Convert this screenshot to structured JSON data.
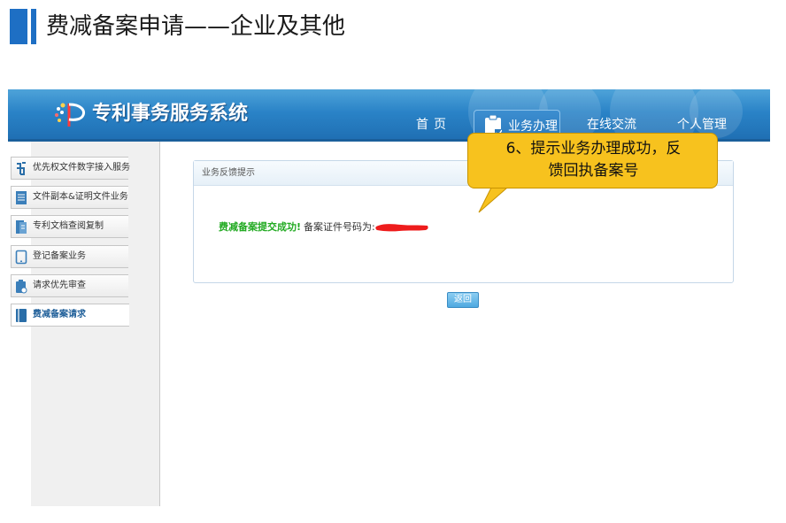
{
  "slide": {
    "title": "费减备案申请——企业及其他"
  },
  "app": {
    "logo_text": "专利事务服务系统",
    "brand_color": "#2a83c7"
  },
  "nav": {
    "items": [
      {
        "label": "首页",
        "active": false
      },
      {
        "label": "业务办理",
        "active": true
      },
      {
        "label": "在线交流",
        "active": false
      },
      {
        "label": "个人管理",
        "active": false
      }
    ]
  },
  "sidebar": {
    "items": [
      {
        "label": "优先权文件数字接入服务",
        "icon": "priority-document-icon",
        "active": false
      },
      {
        "label": "文件副本&证明文件业务",
        "icon": "document-copy-icon",
        "active": false
      },
      {
        "label": "专利文档查阅复制",
        "icon": "document-view-icon",
        "active": false
      },
      {
        "label": "登记备案业务",
        "icon": "tablet-icon",
        "active": false
      },
      {
        "label": "请求优先审查",
        "icon": "priority-review-icon",
        "active": false
      },
      {
        "label": "费减备案请求",
        "icon": "book-icon",
        "active": true
      }
    ]
  },
  "panel": {
    "header": "业务反馈提示",
    "success_text": "费减备案提交成功!",
    "number_text": "备案证件号码为:",
    "success_color": "#22aa22"
  },
  "actions": {
    "return_label": "返回"
  },
  "callout": {
    "line1": "6、提示业务办理成功，反",
    "line2": "馈回执备案号",
    "color": "#f7c21e"
  }
}
